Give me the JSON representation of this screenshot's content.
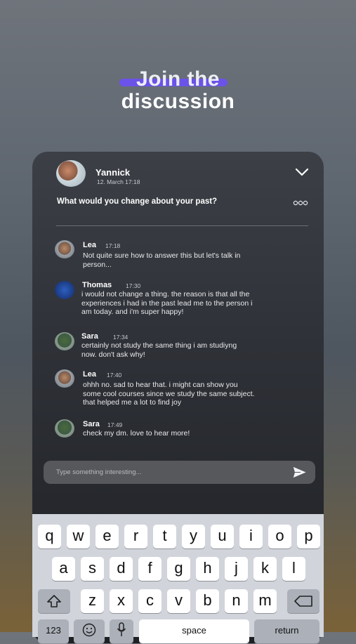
{
  "headline": {
    "line1": "Join the",
    "line2": "discussion"
  },
  "post": {
    "author": "Yannick",
    "date": "12. March 17:18",
    "question": "What would you change about your past?"
  },
  "comments": [
    {
      "name": "Lea",
      "time": "17:18",
      "lines": [
        "Not quite sure how to answer this but let's talk in",
        "person..."
      ]
    },
    {
      "name": "Thomas",
      "time": "17:30",
      "lines": [
        "i would not change a thing. the reason is that all the",
        "experiences i had in the past lead me to the person i",
        "am today. and i'm super happy!"
      ]
    },
    {
      "name": "Sara",
      "time": "17:34",
      "lines": [
        "certainly not study the same thing i am studiyng",
        "now. don't ask why!"
      ]
    },
    {
      "name": "Lea",
      "time": "17:40",
      "lines": [
        "ohhh no. sad to hear that. i might can show you",
        "some cool courses since we study the same subject.",
        "that helped me a lot to find joy"
      ]
    },
    {
      "name": "Sara",
      "time": "17:49",
      "lines": [
        "check my dm. love to hear more!"
      ]
    }
  ],
  "input": {
    "placeholder": "Type something interesting..."
  },
  "keyboard": {
    "row1": [
      "q",
      "w",
      "e",
      "r",
      "t",
      "y",
      "u",
      "i",
      "o",
      "p"
    ],
    "row2": [
      "a",
      "s",
      "d",
      "f",
      "g",
      "h",
      "j",
      "k",
      "l"
    ],
    "row3": [
      "z",
      "x",
      "c",
      "v",
      "b",
      "n",
      "m"
    ],
    "row4": {
      "numbers": "123",
      "space": "space",
      "return": "return"
    }
  },
  "icons": {
    "chevron": "chevron-down-icon",
    "more": "more-options-icon",
    "send": "send-icon",
    "shift": "shift-icon",
    "delete": "delete-icon",
    "emoji": "emoji-icon",
    "mic": "microphone-icon"
  },
  "colors": {
    "accent": "#6b52e8",
    "card": "#2e3137",
    "keyboard": "#d1d4da"
  }
}
